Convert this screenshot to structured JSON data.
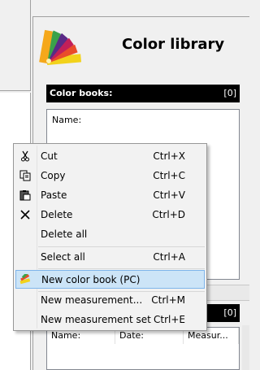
{
  "library": {
    "title": "Color library",
    "books_header": "Color books:",
    "books_count": "[0]",
    "books_column": "Name:",
    "measurements_count": "[0]",
    "measurement_columns": [
      "Name:",
      "Date:",
      "Measur..."
    ]
  },
  "context_menu": {
    "items": [
      {
        "label": "Cut",
        "shortcut": "Ctrl+X",
        "icon": "scissors-icon"
      },
      {
        "label": "Copy",
        "shortcut": "Ctrl+C",
        "icon": "copy-icon"
      },
      {
        "label": "Paste",
        "shortcut": "Ctrl+V",
        "icon": "paste-icon"
      },
      {
        "label": "Delete",
        "shortcut": "Ctrl+D",
        "icon": "delete-x-icon"
      },
      {
        "label": "Delete all",
        "shortcut": ""
      },
      {
        "label": "Select all",
        "shortcut": "Ctrl+A"
      },
      {
        "label": "New color book (PC)",
        "shortcut": "",
        "icon": "color-book-icon",
        "highlighted": true
      },
      {
        "label": "New measurement...",
        "shortcut": "Ctrl+M"
      },
      {
        "label": "New measurement set",
        "shortcut": "Ctrl+E"
      }
    ]
  },
  "colors": {
    "header_bg": "#000000",
    "highlight_bg": "#cce4f7",
    "highlight_border": "#7eb4ea"
  }
}
